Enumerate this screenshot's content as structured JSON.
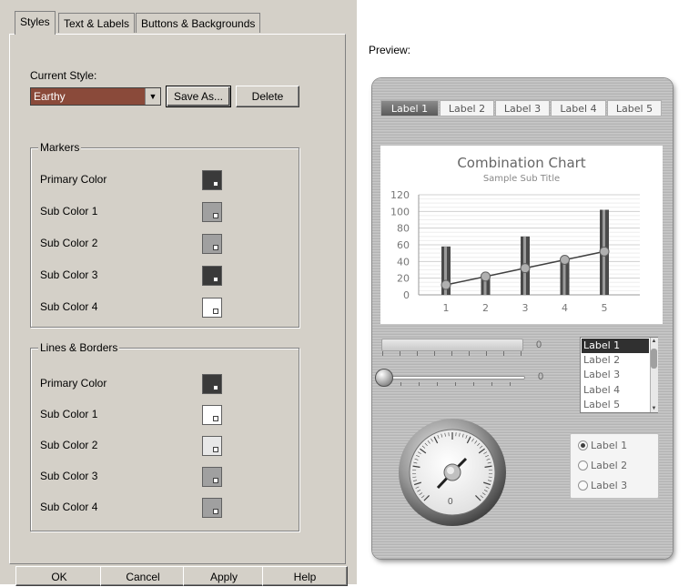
{
  "tabs": [
    "Styles",
    "Text & Labels",
    "Buttons & Backgrounds"
  ],
  "current_style": {
    "label": "Current Style:",
    "value": "Earthy",
    "save_as": "Save As...",
    "delete": "Delete"
  },
  "markers": {
    "title": "Markers",
    "rows": [
      {
        "label": "Primary Color",
        "color": "#3a3a3a"
      },
      {
        "label": "Sub Color 1",
        "color": "#a0a0a0"
      },
      {
        "label": "Sub Color 2",
        "color": "#a0a0a0"
      },
      {
        "label": "Sub Color 3",
        "color": "#3a3a3a"
      },
      {
        "label": "Sub Color 4",
        "color": "#ffffff"
      }
    ]
  },
  "lines_borders": {
    "title": "Lines & Borders",
    "rows": [
      {
        "label": "Primary Color",
        "color": "#3a3a3a"
      },
      {
        "label": "Sub Color 1",
        "color": "#ffffff"
      },
      {
        "label": "Sub Color 2",
        "color": "#e8e8e8"
      },
      {
        "label": "Sub Color 3",
        "color": "#a0a0a0"
      },
      {
        "label": "Sub Color 4",
        "color": "#a0a0a0"
      }
    ]
  },
  "buttons": {
    "ok": "OK",
    "cancel": "Cancel",
    "apply": "Apply",
    "help": "Help"
  },
  "preview": {
    "label": "Preview:",
    "tabs": [
      "Label 1",
      "Label 2",
      "Label 3",
      "Label 4",
      "Label 5"
    ],
    "progress_value": "0",
    "slider_value": "0",
    "list_items": [
      "Label 1",
      "Label 2",
      "Label 3",
      "Label 4",
      "Label 5"
    ],
    "gauge_value": "0",
    "radio_items": [
      "Label 1",
      "Label 2",
      "Label 3"
    ]
  },
  "chart_data": {
    "type": "bar",
    "title": "Combination Chart",
    "subtitle": "Sample Sub Title",
    "categories": [
      "1",
      "2",
      "3",
      "4",
      "5"
    ],
    "series": [
      {
        "type": "bar",
        "values": [
          58,
          25,
          70,
          43,
          102
        ]
      },
      {
        "type": "line",
        "values": [
          12,
          22,
          32,
          42,
          52
        ]
      }
    ],
    "ylim": [
      0,
      120
    ],
    "yticks": [
      "0",
      "20",
      "40",
      "60",
      "80",
      "100",
      "120"
    ],
    "grid": true
  }
}
